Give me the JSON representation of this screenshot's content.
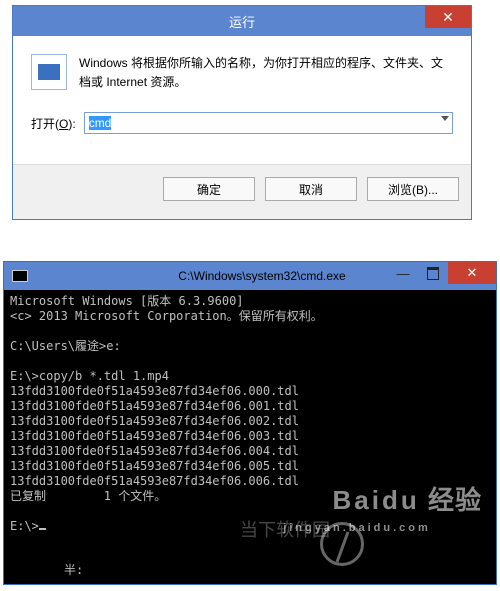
{
  "run": {
    "title": "运行",
    "description": "Windows 将根据你所输入的名称，为你打开相应的程序、文件夹、文档或 Internet 资源。",
    "open_label_pre": "打开(",
    "open_label_key": "O",
    "open_label_post": "):",
    "input_value": "cmd",
    "buttons": {
      "ok": "确定",
      "cancel": "取消",
      "browse": "浏览(B)..."
    }
  },
  "cmd": {
    "title": "C:\\Windows\\system32\\cmd.exe",
    "lines": [
      "Microsoft Windows [版本 6.3.9600]",
      "<c> 2013 Microsoft Corporation。保留所有权利。",
      "",
      "C:\\Users\\履途>e:",
      "",
      "E:\\>copy/b *.tdl 1.mp4",
      "13fdd3100fde0f51a4593e87fd34ef06.000.tdl",
      "13fdd3100fde0f51a4593e87fd34ef06.001.tdl",
      "13fdd3100fde0f51a4593e87fd34ef06.002.tdl",
      "13fdd3100fde0f51a4593e87fd34ef06.003.tdl",
      "13fdd3100fde0f51a4593e87fd34ef06.004.tdl",
      "13fdd3100fde0f51a4593e87fd34ef06.005.tdl",
      "13fdd3100fde0f51a4593e87fd34ef06.006.tdl",
      "已复制        1 个文件。",
      "",
      "E:\\>"
    ],
    "bottom_fragment": "半:"
  },
  "watermark": {
    "brand": "Baidu",
    "sub": "jingyan.baidu.com",
    "center": "当下软件园"
  }
}
